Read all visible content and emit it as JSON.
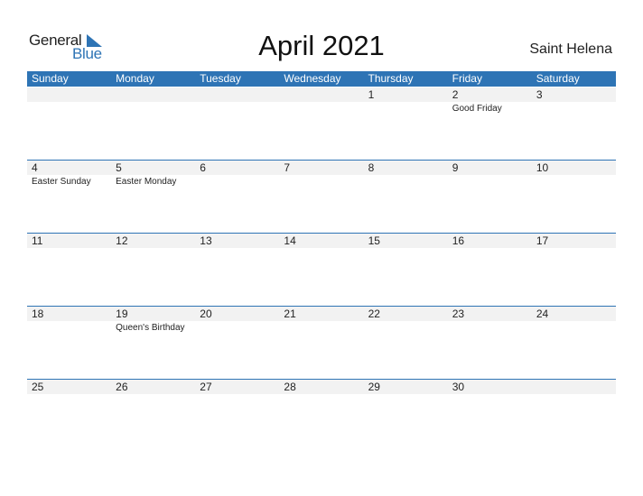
{
  "logo": {
    "word1": "General",
    "word2": "Blue"
  },
  "title": "April 2021",
  "country": "Saint Helena",
  "colors": {
    "accent": "#2e74b5",
    "band": "#f2f2f2"
  },
  "weekdays": [
    "Sunday",
    "Monday",
    "Tuesday",
    "Wednesday",
    "Thursday",
    "Friday",
    "Saturday"
  ],
  "weeks": [
    [
      {
        "day": "",
        "holiday": ""
      },
      {
        "day": "",
        "holiday": ""
      },
      {
        "day": "",
        "holiday": ""
      },
      {
        "day": "",
        "holiday": ""
      },
      {
        "day": "1",
        "holiday": ""
      },
      {
        "day": "2",
        "holiday": "Good Friday"
      },
      {
        "day": "3",
        "holiday": ""
      }
    ],
    [
      {
        "day": "4",
        "holiday": "Easter Sunday"
      },
      {
        "day": "5",
        "holiday": "Easter Monday"
      },
      {
        "day": "6",
        "holiday": ""
      },
      {
        "day": "7",
        "holiday": ""
      },
      {
        "day": "8",
        "holiday": ""
      },
      {
        "day": "9",
        "holiday": ""
      },
      {
        "day": "10",
        "holiday": ""
      }
    ],
    [
      {
        "day": "11",
        "holiday": ""
      },
      {
        "day": "12",
        "holiday": ""
      },
      {
        "day": "13",
        "holiday": ""
      },
      {
        "day": "14",
        "holiday": ""
      },
      {
        "day": "15",
        "holiday": ""
      },
      {
        "day": "16",
        "holiday": ""
      },
      {
        "day": "17",
        "holiday": ""
      }
    ],
    [
      {
        "day": "18",
        "holiday": ""
      },
      {
        "day": "19",
        "holiday": "Queen's Birthday"
      },
      {
        "day": "20",
        "holiday": ""
      },
      {
        "day": "21",
        "holiday": ""
      },
      {
        "day": "22",
        "holiday": ""
      },
      {
        "day": "23",
        "holiday": ""
      },
      {
        "day": "24",
        "holiday": ""
      }
    ],
    [
      {
        "day": "25",
        "holiday": ""
      },
      {
        "day": "26",
        "holiday": ""
      },
      {
        "day": "27",
        "holiday": ""
      },
      {
        "day": "28",
        "holiday": ""
      },
      {
        "day": "29",
        "holiday": ""
      },
      {
        "day": "30",
        "holiday": ""
      },
      {
        "day": "",
        "holiday": ""
      }
    ]
  ]
}
